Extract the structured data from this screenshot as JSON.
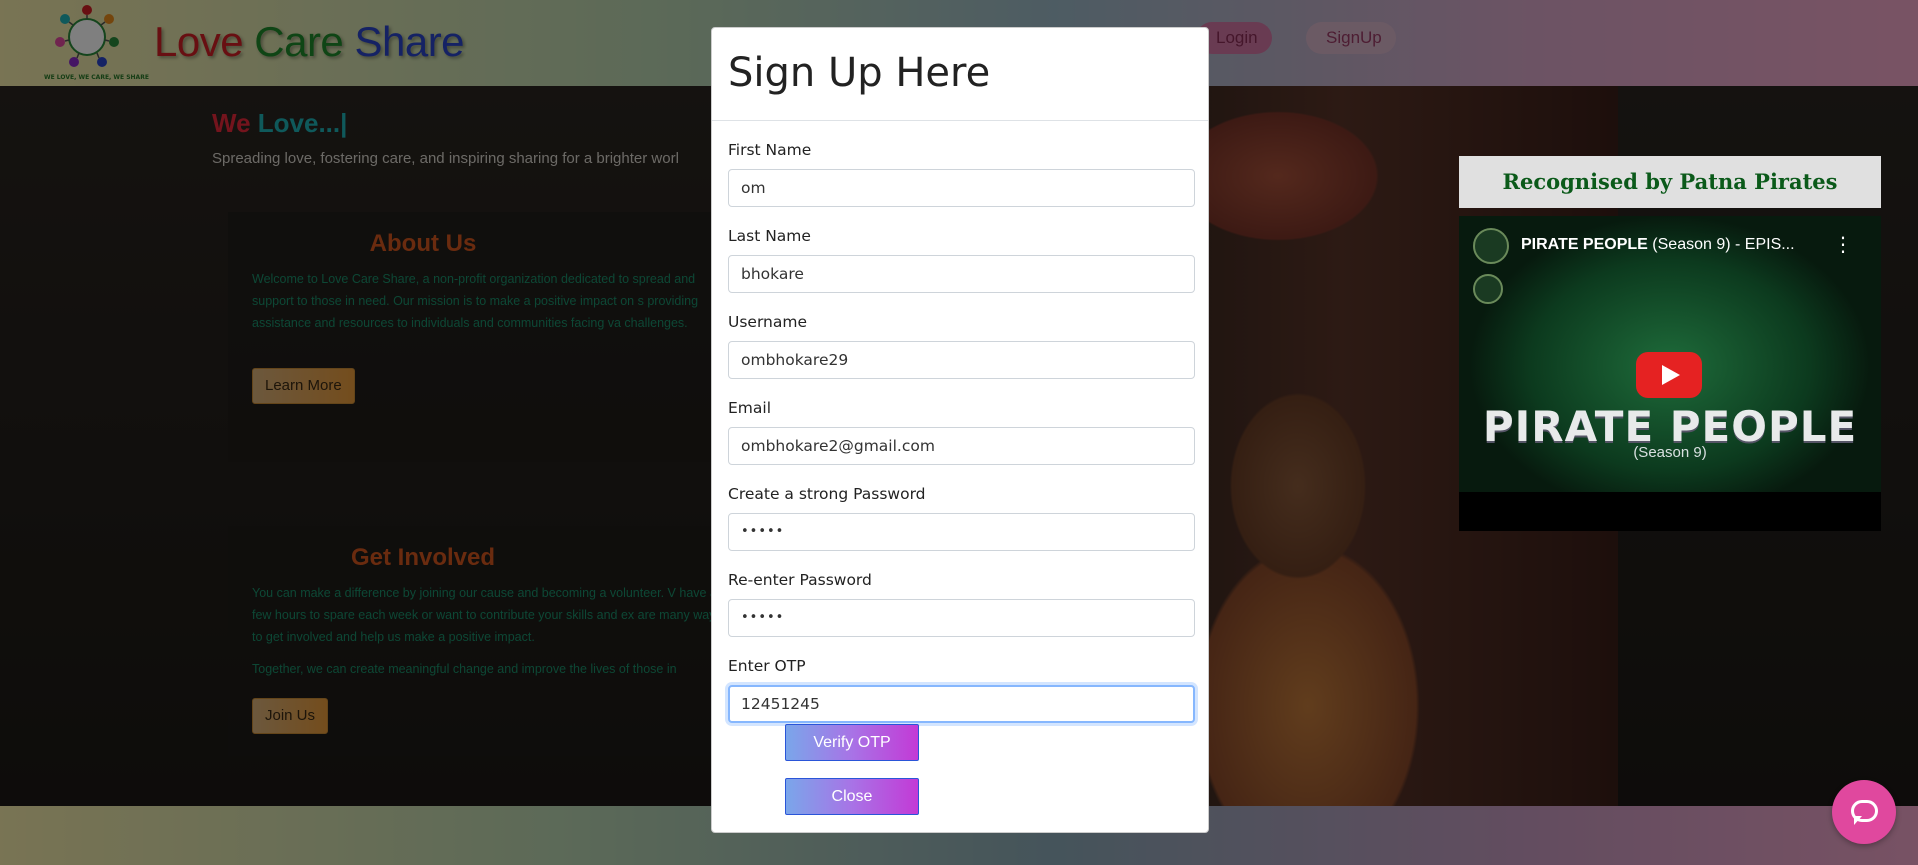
{
  "header": {
    "brand": {
      "w1": "Love",
      "w2": "Care",
      "w3": "Share"
    },
    "logo_caption": "WE LOVE, WE CARE, WE SHARE",
    "nav": {
      "login": "Login",
      "signup": "SignUp"
    }
  },
  "hero": {
    "we": "We",
    "love": "Love...|",
    "subtitle": "Spreading love, fostering care, and inspiring sharing for a brighter worl"
  },
  "about": {
    "title": "About Us",
    "text": "Welcome to Love Care Share, a non-profit organization dedicated to spread and support to those in need. Our mission is to make a positive impact on s providing assistance and resources to individuals and communities facing va challenges.",
    "button": "Learn More"
  },
  "involved": {
    "title": "Get Involved",
    "text": "You can make a difference by joining our cause and becoming a volunteer. V have a few hours to spare each week or want to contribute your skills and ex are many ways to get involved and help us make a positive impact.",
    "text2": "Together, we can create meaningful change and improve the lives of those in",
    "button": "Join Us"
  },
  "recognition": {
    "heading": "Recognised by Patna Pirates",
    "video_title_bold": "PIRATE PEOPLE",
    "video_title_rest": " (Season 9) - EPIS...",
    "video_big": "PIRATE PEOPLE",
    "video_sub": "(Season 9)"
  },
  "modal": {
    "title": "Sign Up Here",
    "fields": [
      {
        "label": "First Name",
        "value": "om"
      },
      {
        "label": "Last Name",
        "value": "bhokare"
      },
      {
        "label": "Username",
        "value": "ombhokare29"
      },
      {
        "label": "Email",
        "value": "ombhokare2@gmail.com"
      },
      {
        "label": "Create a strong Password",
        "value": "•••••"
      },
      {
        "label": "Re-enter Password",
        "value": "•••••"
      },
      {
        "label": "Enter OTP",
        "value": "12451245"
      }
    ],
    "verify_button": "Verify OTP",
    "close_button": "Close"
  },
  "colors": {
    "brand_red": "#d11f24",
    "brand_green": "#1f8a2a",
    "brand_blue": "#2a45c8",
    "chat": "#e0489e"
  },
  "icons": [
    "chat-icon",
    "play-icon",
    "more-vert-icon"
  ]
}
